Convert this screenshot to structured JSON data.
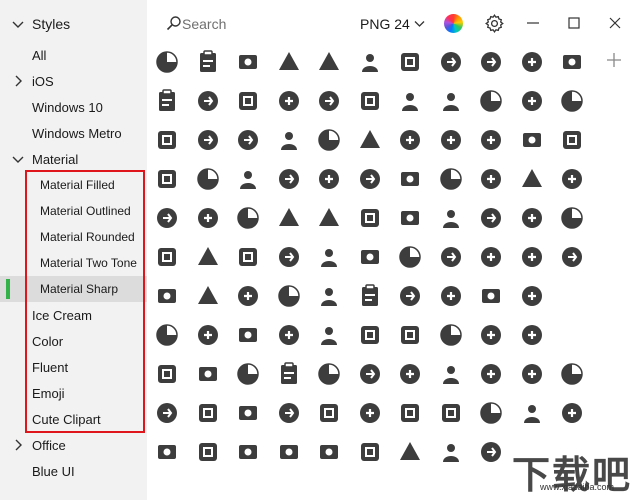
{
  "sidebar": {
    "header_label": "Styles",
    "items": [
      {
        "label": "All",
        "kind": "top",
        "expander": "none"
      },
      {
        "label": "iOS",
        "kind": "top",
        "expander": "collapsed"
      },
      {
        "label": "Windows 10",
        "kind": "top",
        "expander": "none"
      },
      {
        "label": "Windows Metro",
        "kind": "top",
        "expander": "none"
      },
      {
        "label": "Material",
        "kind": "top",
        "expander": "expanded"
      },
      {
        "label": "Material Filled",
        "kind": "sub",
        "expander": "none"
      },
      {
        "label": "Material Outlined",
        "kind": "sub",
        "expander": "none"
      },
      {
        "label": "Material Rounded",
        "kind": "sub",
        "expander": "none"
      },
      {
        "label": "Material Two Tone",
        "kind": "sub",
        "expander": "none"
      },
      {
        "label": "Material Sharp",
        "kind": "sub",
        "expander": "none",
        "selected": true
      },
      {
        "label": "Ice Cream",
        "kind": "top",
        "expander": "none"
      },
      {
        "label": "Color",
        "kind": "top",
        "expander": "none"
      },
      {
        "label": "Fluent",
        "kind": "top",
        "expander": "none"
      },
      {
        "label": "Emoji",
        "kind": "top",
        "expander": "none"
      },
      {
        "label": "Cute Clipart",
        "kind": "top",
        "expander": "none"
      },
      {
        "label": "Office",
        "kind": "top",
        "expander": "collapsed"
      },
      {
        "label": "Blue UI",
        "kind": "top",
        "expander": "none"
      }
    ]
  },
  "toolbar": {
    "search_placeholder": "Search",
    "format_label": "PNG 24"
  },
  "colors": {
    "icon": "#3d3d3d",
    "sidebar_bg": "#f2f2f2",
    "selected_bg": "#dcdcdc",
    "selected_accent": "#33b24a",
    "highlight_border": "#e0161d"
  },
  "icons": [
    [
      "clipboard-icon",
      "walking-person-icon",
      "photo-frame-icon",
      "download-circle-icon",
      "brick-wall-icon",
      "bus-front-icon",
      "typewriter-icon",
      "contact-list-icon",
      "uk-post-icon",
      "id-card-icon",
      "animal-face-icon"
    ],
    [
      "airplane-landing-icon",
      "f10-key-icon",
      "speedometer-icon",
      "key-circle-icon",
      "sunshine-icon",
      "bomb-sliding-icon",
      "manta-ray-icon",
      "fish-icon",
      "avatar-glasses-icon",
      "mother-child-icon",
      "video-camera-icon"
    ],
    [
      "microscope-icon",
      "boat-icon",
      "scooter-icon",
      "virus-icon",
      "oil-rig-icon",
      "barcode-icon",
      "squirrel-icon",
      "restaurant-building-icon",
      "person-icon",
      "email-card-icon",
      "leaf-box-icon"
    ],
    [
      "printer-icon",
      "paper-plane-icon",
      "transfer-people-icon",
      "medal-3-icon",
      "medal-2-icon",
      "document-list-icon",
      "triangle-split-icon",
      "grill-icon",
      "bbq-icon",
      "fire-box-icon",
      "scarecrow-icon"
    ],
    [
      "pie-chart-1-icon",
      "pie-chart-2-icon",
      "pie-chart-3-icon",
      "pie-chart-4-icon",
      "puzzle-icon",
      "pie-chart-5-icon",
      "pie-chart-6-icon",
      "pie-chart-7-icon",
      "pie-chart-8-icon",
      "pie-chart-9-icon",
      "dotted-grid-icon"
    ],
    [
      "arrow-left-circle-icon",
      "arrow-right-circle-icon",
      "game-controller-icon",
      "car-badge-icon",
      "percent-icon",
      "video-message-icon",
      "bowl-icon",
      "watch-icon",
      "calendar-star-icon",
      "calendar-blocked-icon",
      "calendar-clock-icon"
    ],
    [
      "brick-truck-icon",
      "person-cleaning-icon",
      "armchair-icon",
      "bookmark-icon",
      "ladder-chair-icon",
      "balloons-icon",
      "balloon-icon",
      "arrow-up-circle-icon",
      "arrow-up-circle-alt-icon",
      "arrow-left-circle-alt-icon",
      "empty-cell"
    ],
    [
      "login-circle-icon",
      "coffee-cup-icon",
      "coffee-cup-alt-icon",
      "no-phone-icon",
      "open-sign-icon",
      "close-sign-icon",
      "document-edit-icon",
      "translate-icon",
      "discord-icon",
      "phone-call-icon",
      "empty-cell"
    ],
    [
      "key-list-icon",
      "keyboard-icon",
      "cloud-lightning-icon",
      "parking-gate-icon",
      "chalk-icon",
      "trophy-icon",
      "helmet-icon",
      "ps-file-icon",
      "book-reading-icon",
      "fishing-icon",
      "washing-machine-icon"
    ],
    [
      "watering-can-icon",
      "newspaper-layout-icon",
      "brackets-icon",
      "heart-balloon-icon",
      "team-time-icon",
      "up-arrow-icon",
      "no-bell-icon",
      "video-chat-icon",
      "wrench-icon",
      "o3-icon",
      "airplane-emblem-icon"
    ],
    [
      "monitor-icon",
      "drill-icon",
      "camera-square-icon",
      "apk-file-icon",
      "swap-arrows-icon",
      "leaf-sync-icon",
      "vr-glasses-icon",
      "copy-file-icon",
      "document-settings-icon",
      "empty-cell",
      "empty-cell"
    ]
  ],
  "watermark": {
    "main_text": "下载吧",
    "sub_text": "www.xiazaiba.com"
  }
}
